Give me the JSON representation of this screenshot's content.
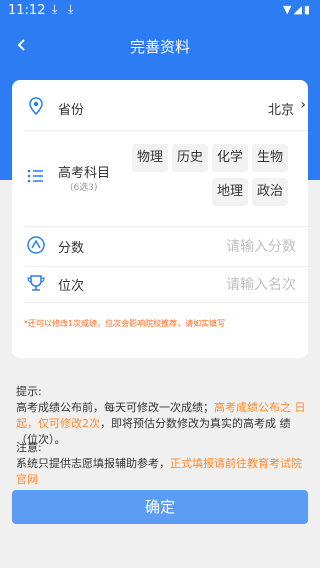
{
  "status": {
    "time": "11:12"
  },
  "nav": {
    "title": "完善资料"
  },
  "form": {
    "province": {
      "label": "省份",
      "value": "北京"
    },
    "subjects": {
      "label": "高考科目",
      "hint": "(6选3)",
      "options": [
        "物理",
        "历史",
        "化学",
        "生物",
        "地理",
        "政治"
      ]
    },
    "score": {
      "label": "分数",
      "placeholder": "请输入分数"
    },
    "rank": {
      "label": "位次",
      "placeholder": "请输入名次"
    },
    "note": "*还可以修改1次成绩，位次会影响院校推荐，请如实填写"
  },
  "tips": {
    "title": "提示:",
    "part1": "高考成绩公布前，每天可修改一次成绩；",
    "highlight1": "高考成绩公布之 日起，仅可修改2次",
    "part2": "，即将预估分数修改为真实的高考成 绩（位次）。",
    "notice_title": "注意:",
    "notice_text": "系统只提供志愿填报辅助参考，",
    "notice_highlight": "正式填报请前往教育考试院官网"
  },
  "actions": {
    "confirm": "确定"
  },
  "colors": {
    "primary": "#2c7cf4",
    "accent": "#ff8a2a",
    "button": "#5b9cf5"
  }
}
